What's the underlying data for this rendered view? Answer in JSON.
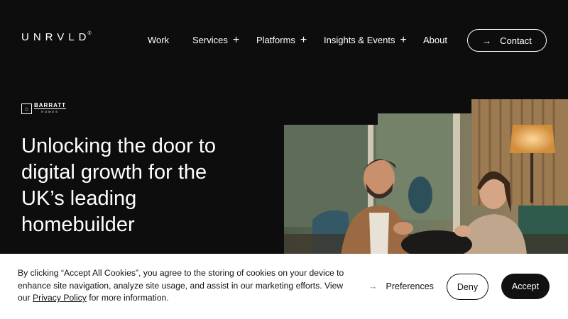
{
  "header": {
    "logo": "UNRVLD",
    "logo_mark": "®",
    "nav": [
      {
        "label": "Work",
        "has_plus": false
      },
      {
        "label": "Services",
        "has_plus": true
      },
      {
        "label": "Platforms",
        "has_plus": true
      },
      {
        "label": "Insights & Events",
        "has_plus": true
      },
      {
        "label": "About",
        "has_plus": false
      }
    ],
    "plus_glyph": "+",
    "contact_label": "Contact",
    "arrow_glyph": "→"
  },
  "hero": {
    "client_logo_top": "BARRATT",
    "client_logo_bottom": "HOMES",
    "title": "Unlocking the door to digital growth for the UK’s leading homebuilder"
  },
  "cookie": {
    "text_before": "By clicking “Accept All Cookies”, you agree to the storing of cookies on your device to enhance site navigation, analyze site usage, and assist in our marketing efforts. View our ",
    "policy_link": "Privacy Policy",
    "text_after": " for more information.",
    "preferences_label": "Preferences",
    "deny_label": "Deny",
    "accept_label": "Accept"
  },
  "colors": {
    "background": "#0d0d0d",
    "banner": "#ffffff",
    "accept_bg": "#111111"
  }
}
